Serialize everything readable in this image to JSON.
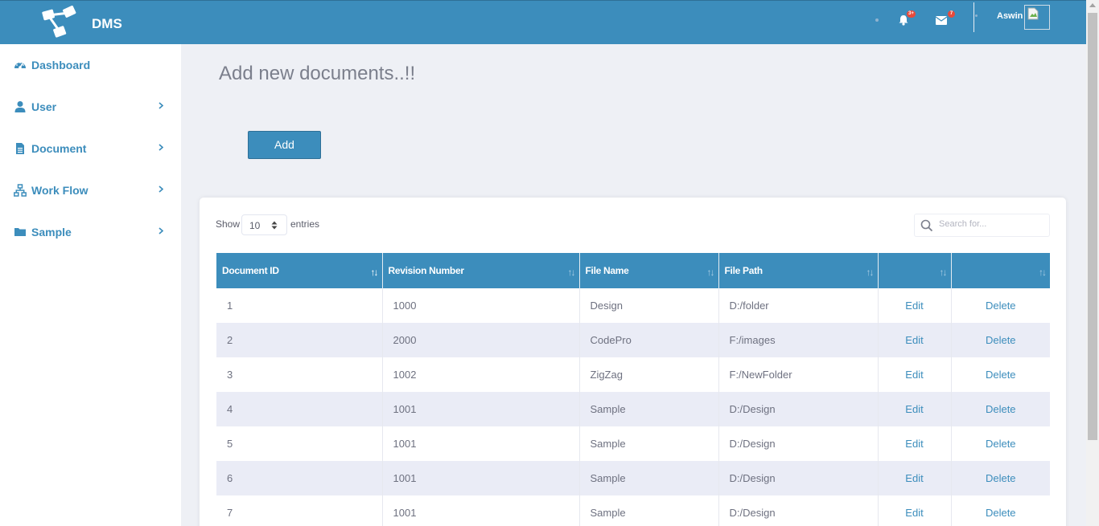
{
  "header": {
    "brand": "DMS",
    "notifications_badge": "3+",
    "messages_badge": "7",
    "user_name": "Aswin"
  },
  "sidebar": {
    "items": [
      {
        "label": "Dashboard",
        "icon": "dashboard-icon",
        "has_submenu": false
      },
      {
        "label": "User",
        "icon": "user-icon",
        "has_submenu": true
      },
      {
        "label": "Document",
        "icon": "document-icon",
        "has_submenu": true
      },
      {
        "label": "Work Flow",
        "icon": "sitemap-icon",
        "has_submenu": true
      },
      {
        "label": "Sample",
        "icon": "folder-icon",
        "has_submenu": true
      }
    ]
  },
  "main": {
    "title": "Add new documents..!!",
    "add_label": "Add"
  },
  "table_controls": {
    "show_label": "Show",
    "entries_value": "10",
    "entries_label": "entries",
    "search_placeholder": "Search for..."
  },
  "table": {
    "columns": [
      "Document ID",
      "Revision Number",
      "File Name",
      "File Path",
      "",
      ""
    ],
    "rows": [
      {
        "id": "1",
        "revision": "1000",
        "file_name": "Design",
        "file_path": "D:/folder",
        "edit": "Edit",
        "delete": "Delete"
      },
      {
        "id": "2",
        "revision": "2000",
        "file_name": "CodePro",
        "file_path": "F:/images",
        "edit": "Edit",
        "delete": "Delete"
      },
      {
        "id": "3",
        "revision": "1002",
        "file_name": "ZigZag",
        "file_path": "F:/NewFolder",
        "edit": "Edit",
        "delete": "Delete"
      },
      {
        "id": "4",
        "revision": "1001",
        "file_name": "Sample",
        "file_path": "D:/Design",
        "edit": "Edit",
        "delete": "Delete"
      },
      {
        "id": "5",
        "revision": "1001",
        "file_name": "Sample",
        "file_path": "D:/Design",
        "edit": "Edit",
        "delete": "Delete"
      },
      {
        "id": "6",
        "revision": "1001",
        "file_name": "Sample",
        "file_path": "D:/Design",
        "edit": "Edit",
        "delete": "Delete"
      },
      {
        "id": "7",
        "revision": "1001",
        "file_name": "Sample",
        "file_path": "D:/Design",
        "edit": "Edit",
        "delete": "Delete"
      }
    ]
  },
  "colors": {
    "primary": "#3c8dbc",
    "badge": "#e74a3b",
    "background": "#eef0f5",
    "stripe": "#eaecf6"
  }
}
